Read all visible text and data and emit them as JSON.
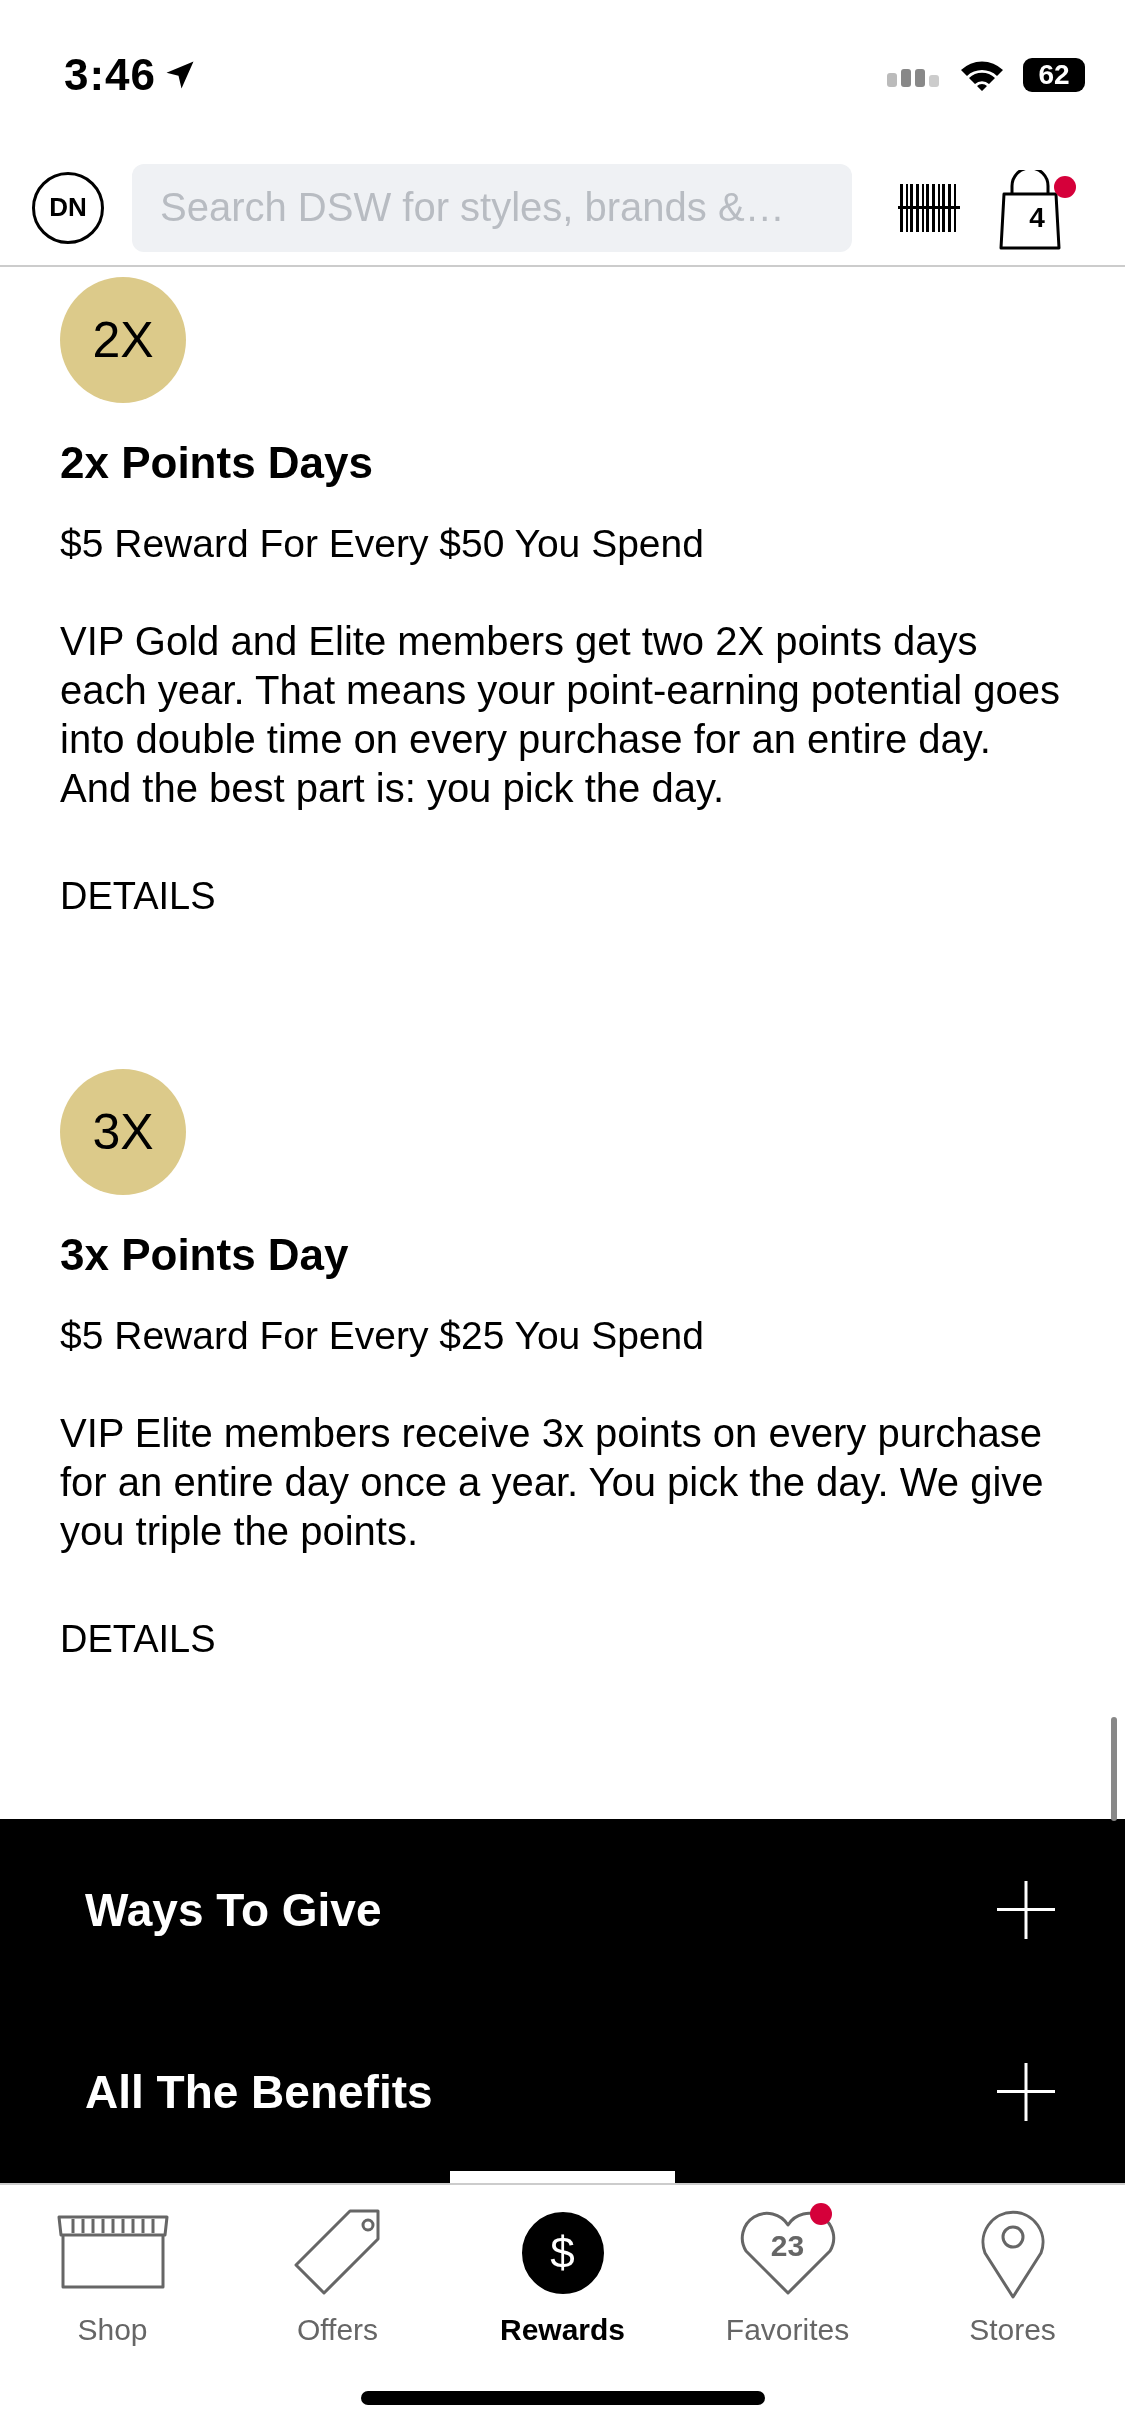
{
  "status_bar": {
    "time": "3:46",
    "battery": "62"
  },
  "header": {
    "avatar": "DN",
    "search": {
      "placeholder": "Search DSW for styles, brands &…"
    },
    "bag": {
      "count": "4",
      "badge": true
    }
  },
  "rewards": [
    {
      "badge": "2X",
      "title": "2x Points Days",
      "subtitle": "$5 Reward For Every $50 You Spend",
      "description": "VIP Gold and Elite members get two 2X points days each year. That means your point-earning potential goes into double time on every purchase for an entire day. And the best part is: you pick the day.",
      "link": "DETAILS"
    },
    {
      "badge": "3X",
      "title": "3x Points Day",
      "subtitle": "$5 Reward For Every $25 You Spend",
      "description": "VIP Elite members receive 3x points on every purchase for an entire day once a year. You pick the day. We give you triple the points.",
      "link": "DETAILS"
    }
  ],
  "sections": [
    {
      "title": "Ways To Give",
      "expanded": false
    },
    {
      "title": "All The Benefits",
      "expanded": false
    }
  ],
  "tabs": [
    {
      "kind": "shop",
      "label": "Shop",
      "selected": false
    },
    {
      "kind": "offers",
      "label": "Offers",
      "selected": false
    },
    {
      "kind": "rewards",
      "label": "Rewards",
      "symbol": "$",
      "selected": true
    },
    {
      "kind": "favorites",
      "label": "Favorites",
      "count": "23",
      "badge": true,
      "selected": false
    },
    {
      "kind": "stores",
      "label": "Stores",
      "selected": false
    }
  ]
}
